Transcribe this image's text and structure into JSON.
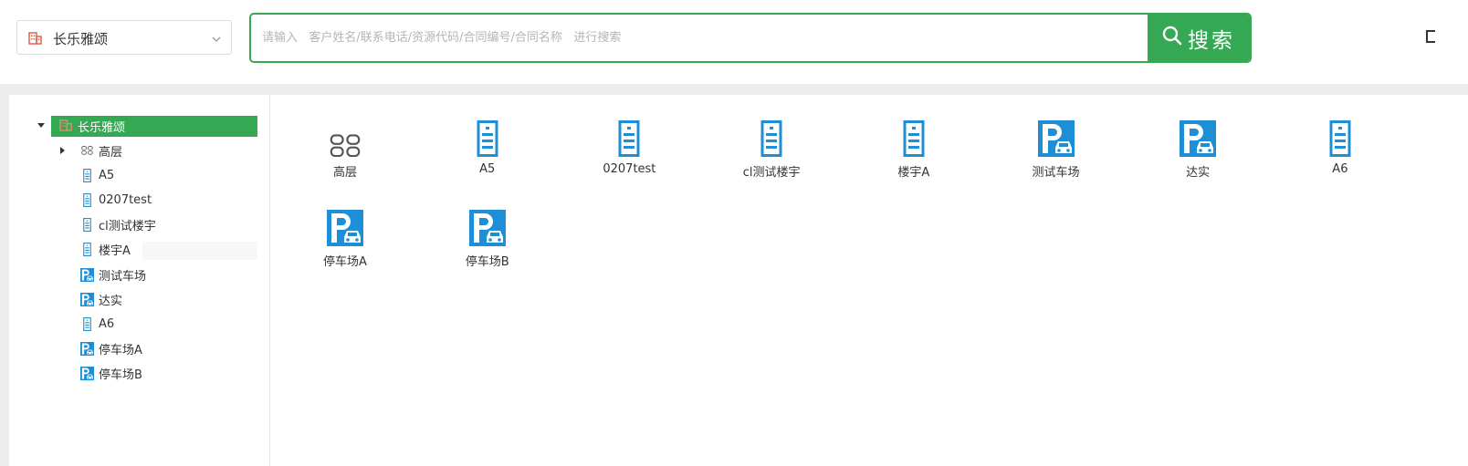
{
  "header": {
    "project_select": {
      "label": "长乐雅颂",
      "icon": "building-icon"
    },
    "search": {
      "placeholder": "请输入   客户姓名/联系电话/资源代码/合同编号/合同名称   进行搜索",
      "value": "",
      "button_label": "搜索",
      "button_icon": "search-icon"
    }
  },
  "tree": {
    "root": {
      "label": "长乐雅颂",
      "icon": "building-icon",
      "expanded": true
    },
    "items": [
      {
        "label": "高层",
        "icon": "grid-icon",
        "expandable": true
      },
      {
        "label": "A5",
        "icon": "tower-icon"
      },
      {
        "label": "0207test",
        "icon": "tower-icon"
      },
      {
        "label": "cl测试楼宇",
        "icon": "tower-icon"
      },
      {
        "label": "楼宇A",
        "icon": "tower-icon"
      },
      {
        "label": "测试车场",
        "icon": "parking-icon"
      },
      {
        "label": "达实",
        "icon": "parking-icon"
      },
      {
        "label": "A6",
        "icon": "tower-icon"
      },
      {
        "label": "停车场A",
        "icon": "parking-icon"
      },
      {
        "label": "停车场B",
        "icon": "parking-icon"
      }
    ]
  },
  "grid": {
    "items": [
      {
        "label": "高层",
        "icon": "grid-icon"
      },
      {
        "label": "A5",
        "icon": "tower-icon"
      },
      {
        "label": "0207test",
        "icon": "tower-icon"
      },
      {
        "label": "cl测试楼宇",
        "icon": "tower-icon"
      },
      {
        "label": "楼宇A",
        "icon": "tower-icon"
      },
      {
        "label": "测试车场",
        "icon": "parking-icon"
      },
      {
        "label": "达实",
        "icon": "parking-icon"
      },
      {
        "label": "A6",
        "icon": "tower-icon"
      },
      {
        "label": "停车场A",
        "icon": "parking-icon"
      },
      {
        "label": "停车场B",
        "icon": "parking-icon"
      }
    ]
  },
  "colors": {
    "accent": "#34a853",
    "icon_blue": "#1e8fd6",
    "building_red": "#e0644a"
  }
}
